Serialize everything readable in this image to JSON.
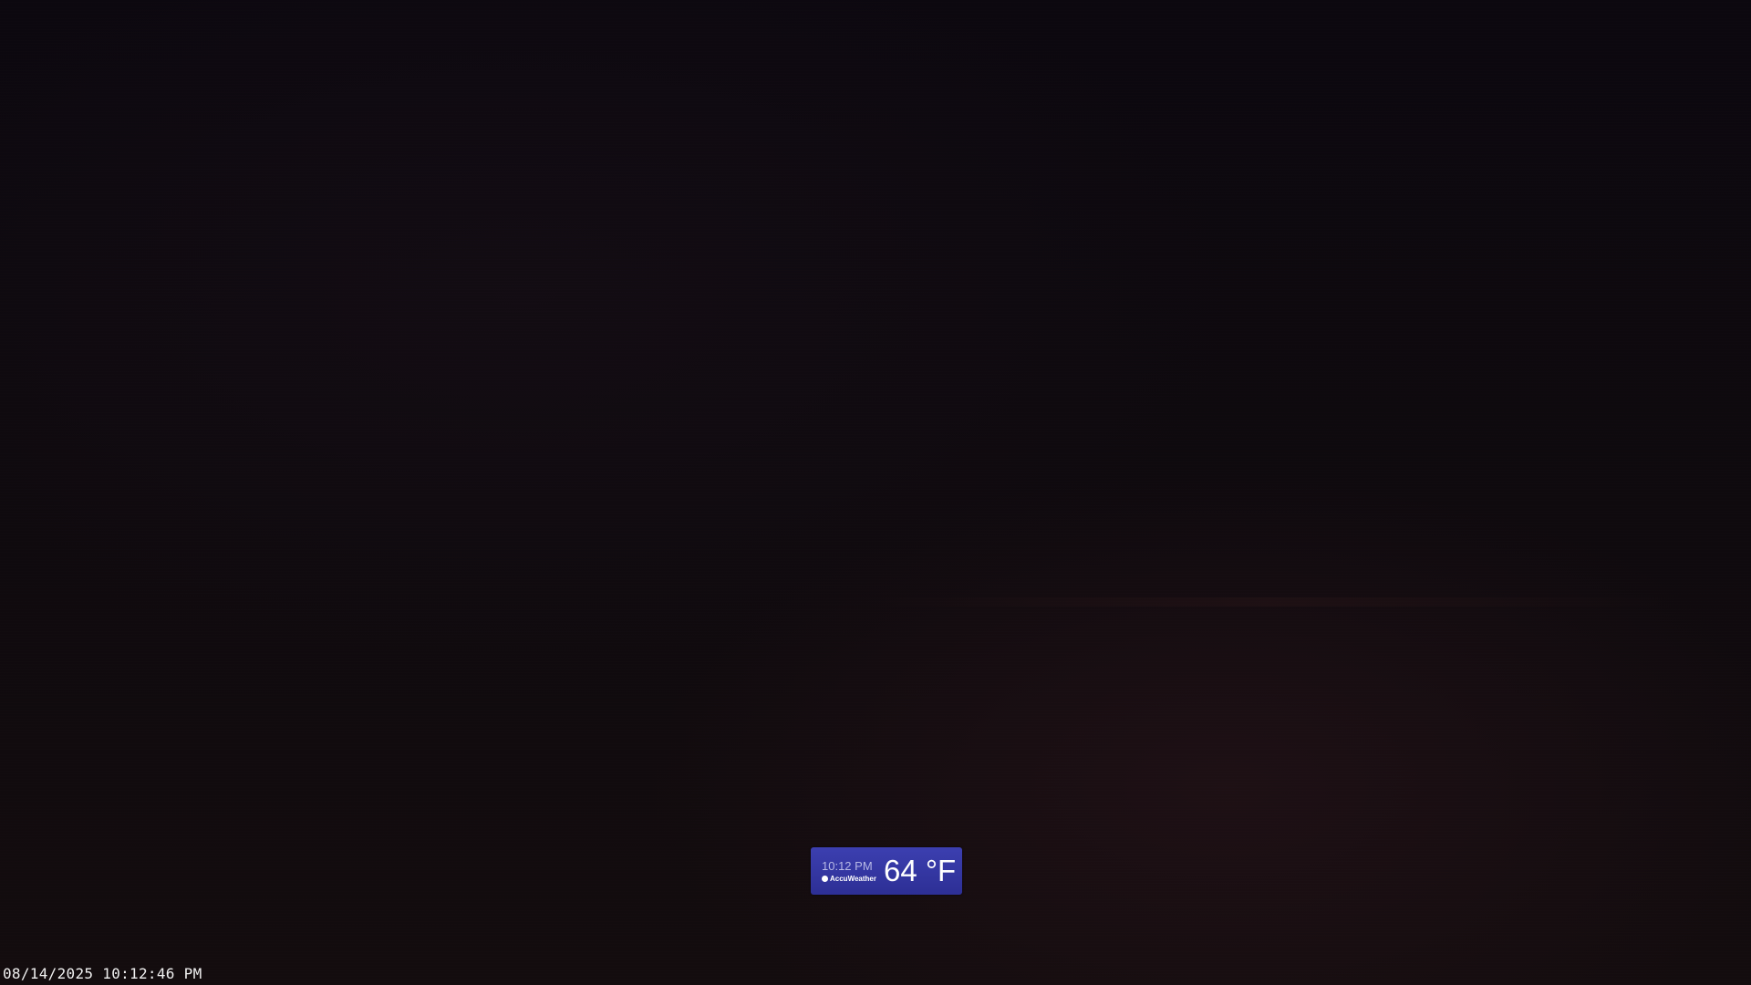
{
  "scene": {
    "description_colors": {
      "background": "#0d080c",
      "badge": "#3c3fb0"
    }
  },
  "weather_badge": {
    "time": "10:12 PM",
    "brand": "AccuWeather",
    "brand_icon": "sun-icon",
    "temperature": "64 °F"
  },
  "camera_overlay": {
    "timestamp": "08/14/2025 10:12:46 PM"
  }
}
